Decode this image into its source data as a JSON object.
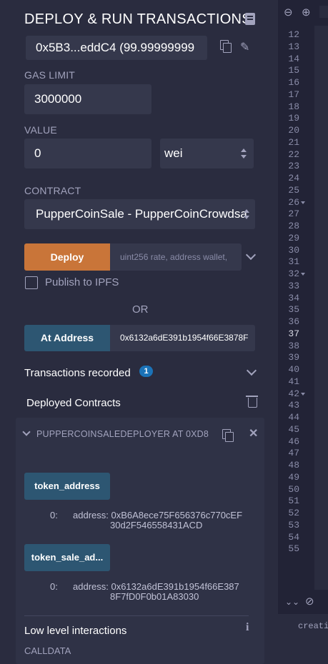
{
  "header": {
    "title": "DEPLOY & RUN TRANSACTIONS"
  },
  "account": {
    "value": "0x5B3...eddC4 (99.99999999"
  },
  "gas_limit": {
    "label": "GAS LIMIT",
    "value": "3000000"
  },
  "value": {
    "label": "VALUE",
    "amount": "0",
    "unit": "wei"
  },
  "contract": {
    "label": "CONTRACT",
    "selected": "PupperCoinSale - PupperCoinCrowdsa"
  },
  "deploy": {
    "button": "Deploy",
    "placeholder": "uint256 rate, address wallet,"
  },
  "publish": {
    "label": "Publish to IPFS"
  },
  "or_text": "OR",
  "at_address": {
    "button": "At Address",
    "value": "0x6132a6dE391b1954f66E3878F"
  },
  "transactions": {
    "label": "Transactions recorded",
    "count": "1"
  },
  "deployed": {
    "label": "Deployed Contracts",
    "instance_title": "PUPPERCOINSALEDEPLOYER AT 0XD8",
    "functions": [
      {
        "name": "token_address",
        "out_index": "0:",
        "out_text_1": "address: 0xB6A8ece75F656376c770cEF",
        "out_text_2": "30d2F546558431ACD"
      },
      {
        "name": "token_sale_ad...",
        "out_index": "0:",
        "out_text_1": "address: 0x6132a6dE391b1954f66E387",
        "out_text_2": "8F7fD0F0b01A83030"
      }
    ],
    "low_level": "Low level interactions",
    "calldata": "CALLDATA"
  },
  "editor": {
    "line_numbers": [
      "12",
      "13",
      "14",
      "15",
      "16",
      "17",
      "18",
      "19",
      "20",
      "21",
      "22",
      "23",
      "24",
      "25",
      "26",
      "27",
      "28",
      "29",
      "30",
      "31",
      "32",
      "33",
      "34",
      "35",
      "36",
      "37",
      "38",
      "39",
      "40",
      "41",
      "42",
      "43",
      "44",
      "45",
      "46",
      "47",
      "48",
      "49",
      "50",
      "51",
      "52",
      "53",
      "54",
      "55"
    ],
    "active_line": "37",
    "terminal_text": "creati"
  },
  "colors": {
    "accent_deploy": "#c97539",
    "accent_blue": "#2d5672",
    "badge": "#1b73b8",
    "panel": "#2a2c3f"
  }
}
